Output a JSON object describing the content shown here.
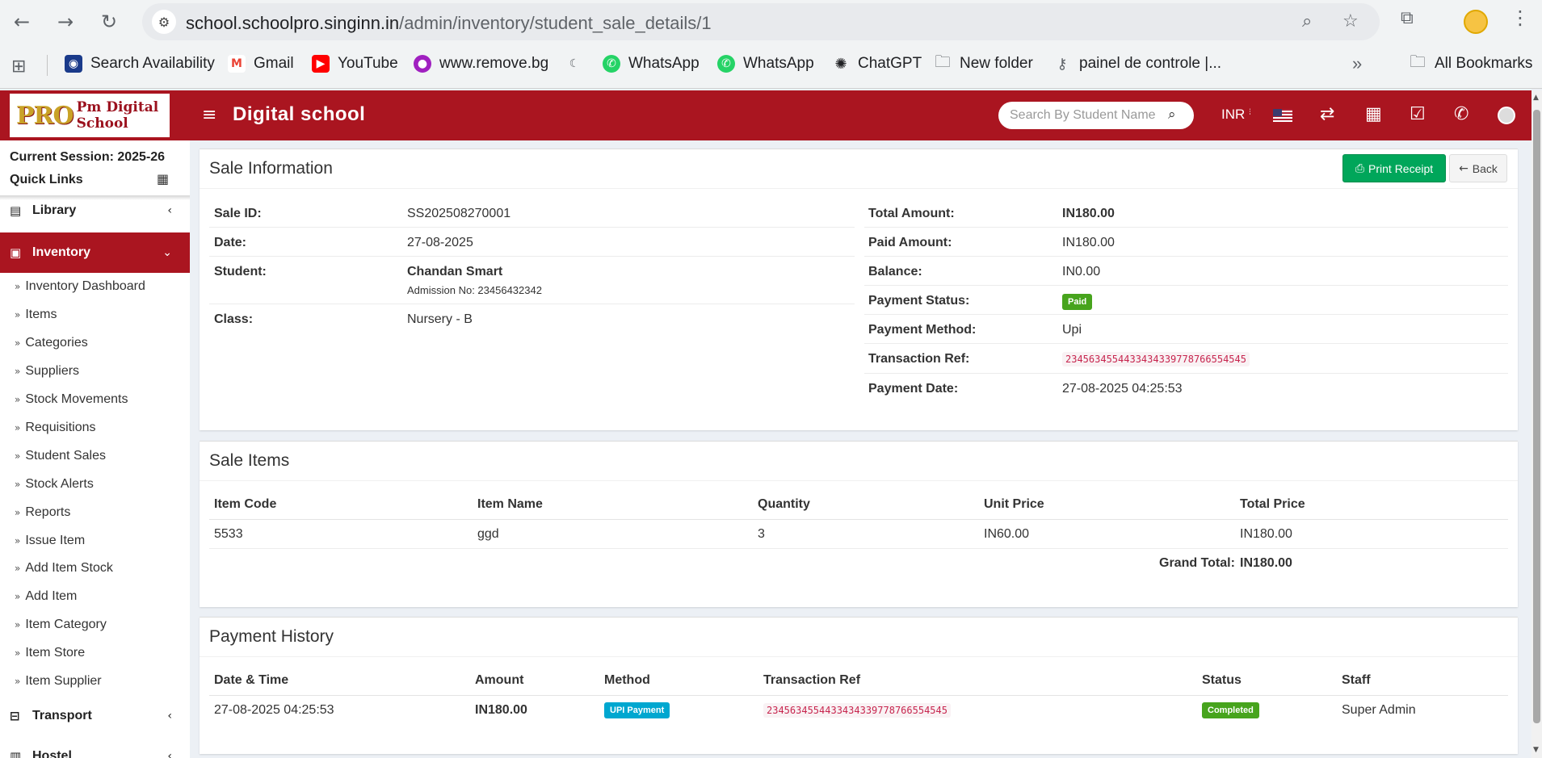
{
  "browser": {
    "url_host": "school.schoolpro.singinn.in",
    "url_path": "/admin/inventory/student_sale_details/1",
    "bookmarks": [
      {
        "label": "Search Availability",
        "icon": "train-icon",
        "color": "#1a3a8a"
      },
      {
        "label": "Gmail",
        "icon": "gmail-icon",
        "color": "#ea4335"
      },
      {
        "label": "YouTube",
        "icon": "youtube-icon",
        "color": "#ff0000"
      },
      {
        "label": "www.remove.bg",
        "icon": "removebg-icon",
        "color": "#a020c0"
      },
      {
        "label": "",
        "icon": "moon-icon",
        "color": "#5f6368"
      },
      {
        "label": "WhatsApp",
        "icon": "whatsapp-icon",
        "color": "#25d366"
      },
      {
        "label": "WhatsApp",
        "icon": "whatsapp-icon",
        "color": "#25d366"
      },
      {
        "label": "ChatGPT",
        "icon": "chatgpt-icon",
        "color": "#202124"
      },
      {
        "label": "New folder",
        "icon": "folder-icon",
        "color": "#5f6368"
      },
      {
        "label": "painel de controle |...",
        "icon": "key-icon",
        "color": "#5f6368"
      }
    ],
    "all_bookmarks": "All Bookmarks",
    "overflow": "»"
  },
  "header": {
    "logo_pro": "PRO",
    "logo_text": "Pm Digital School",
    "brand": "Digital school",
    "search_placeholder": "Search By Student Name",
    "currency": "INR ₹",
    "colors": {
      "primary": "#aa1520"
    }
  },
  "sidebar": {
    "session": "Current Session: 2025-26",
    "quick_links": "Quick Links",
    "library": "Library",
    "inventory": "Inventory",
    "transport": "Transport",
    "hostel": "Hostel",
    "items": [
      "Inventory Dashboard",
      "Items",
      "Categories",
      "Suppliers",
      "Stock Movements",
      "Requisitions",
      "Student Sales",
      "Stock Alerts",
      "Reports",
      "Issue Item",
      "Add Item Stock",
      "Add Item",
      "Item Category",
      "Item Store",
      "Item Supplier"
    ]
  },
  "sale_info": {
    "title": "Sale Information",
    "print_label": "Print Receipt",
    "back_label": "Back",
    "left": {
      "sale_id_label": "Sale ID:",
      "sale_id": "SS202508270001",
      "date_label": "Date:",
      "date": "27-08-2025",
      "student_label": "Student:",
      "student_name": "Chandan Smart",
      "admission": "Admission No: 23456432342",
      "class_label": "Class:",
      "class": "Nursery - B"
    },
    "right": {
      "total_label": "Total Amount:",
      "total": "IN180.00",
      "paid_label": "Paid Amount:",
      "paid": "IN180.00",
      "balance_label": "Balance:",
      "balance": "IN0.00",
      "status_label": "Payment Status:",
      "status": "Paid",
      "method_label": "Payment Method:",
      "method": "Upi",
      "ref_label": "Transaction Ref:",
      "ref": "2345634554433434339778766554545",
      "pdate_label": "Payment Date:",
      "pdate": "27-08-2025 04:25:53"
    }
  },
  "sale_items": {
    "title": "Sale Items",
    "headers": [
      "Item Code",
      "Item Name",
      "Quantity",
      "Unit Price",
      "Total Price"
    ],
    "rows": [
      [
        "5533",
        "ggd",
        "3",
        "IN60.00",
        "IN180.00"
      ]
    ],
    "grand_total_label": "Grand Total:",
    "grand_total": "IN180.00"
  },
  "payment_history": {
    "title": "Payment History",
    "headers": [
      "Date & Time",
      "Amount",
      "Method",
      "Transaction Ref",
      "Status",
      "Staff"
    ],
    "rows": [
      {
        "datetime": "27-08-2025 04:25:53",
        "amount": "IN180.00",
        "method": "UPI Payment",
        "ref": "2345634554433434339778766554545",
        "status": "Completed",
        "staff": "Super Admin"
      }
    ]
  }
}
